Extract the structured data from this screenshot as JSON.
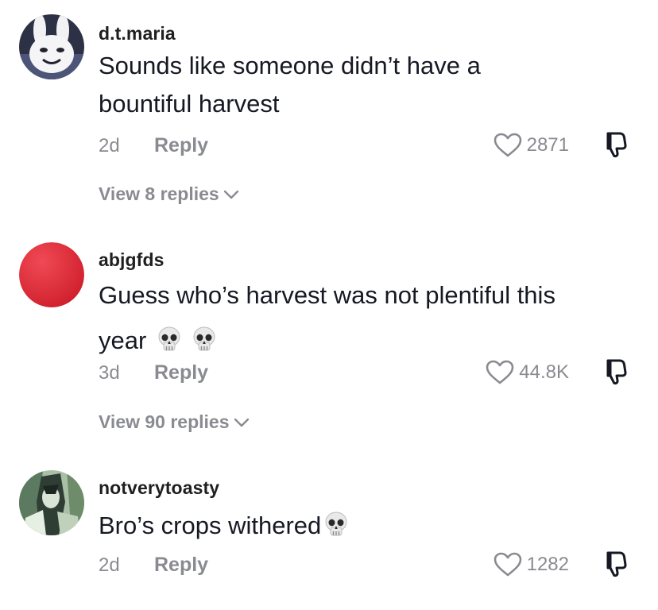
{
  "comments": [
    {
      "username": "d.t.maria",
      "text_line1": "Sounds like someone didn’t have a",
      "text_line2": "bountiful harvest",
      "age": "2d",
      "reply_label": "Reply",
      "likes": "2871",
      "view_replies": "View 8 replies",
      "avatar_icon": "white-rabbit-avatar"
    },
    {
      "username": "abjgfds",
      "text_line1": "Guess who’s harvest was not plentiful this",
      "text_line2": "year",
      "emoji": [
        "skull",
        "skull"
      ],
      "age": "3d",
      "reply_label": "Reply",
      "likes": "44.8K",
      "view_replies": "View 90 replies",
      "avatar_icon": "red-circle-avatar"
    },
    {
      "username": "notverytoasty",
      "text_line1": "Bro’s crops withered",
      "emoji": [
        "skull"
      ],
      "age": "2d",
      "reply_label": "Reply",
      "likes": "1282",
      "avatar_icon": "green-character-avatar"
    }
  ],
  "colors": {
    "text": "#161823",
    "muted": "#8a8b91",
    "avatar_red": "#e0313f"
  }
}
